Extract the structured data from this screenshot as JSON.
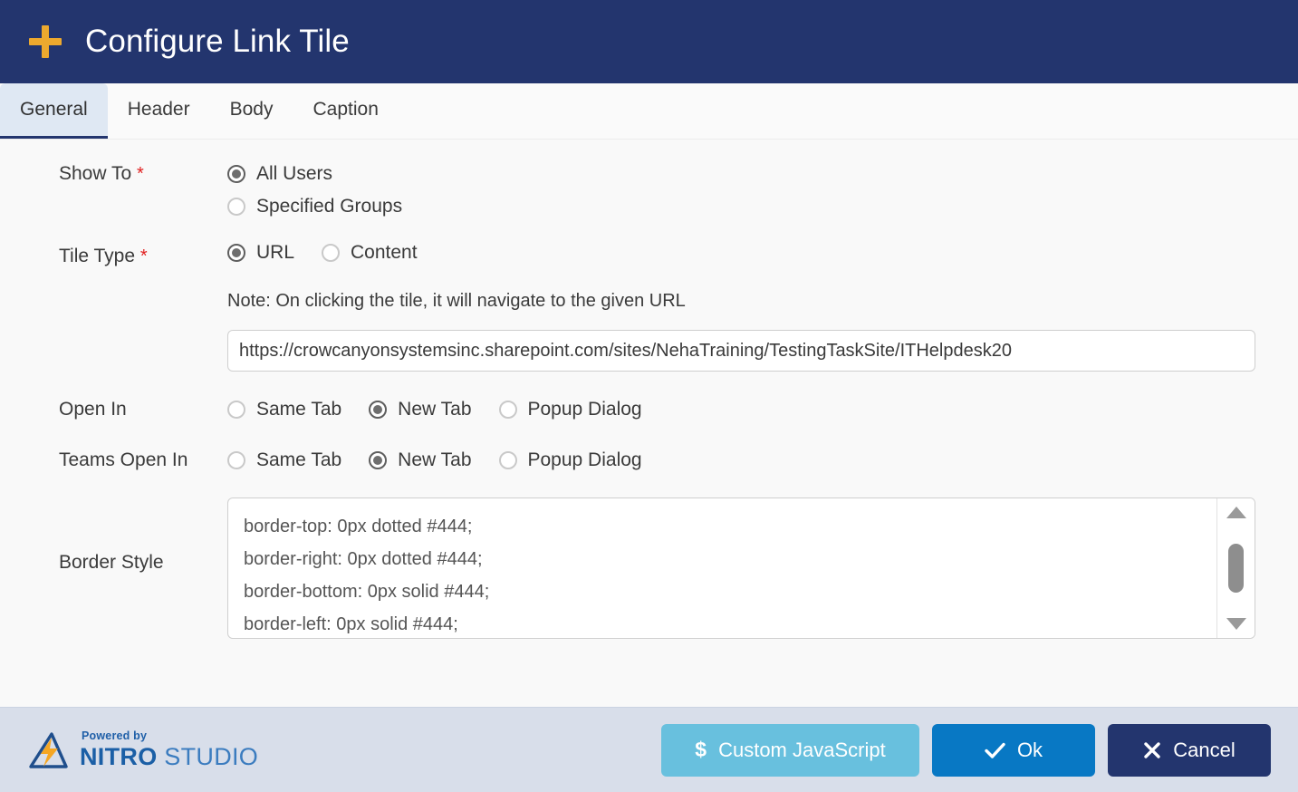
{
  "window": {
    "title": "Configure Link Tile",
    "add_icon": "plus-icon"
  },
  "tabs": [
    {
      "label": "General",
      "active": true
    },
    {
      "label": "Header",
      "active": false
    },
    {
      "label": "Body",
      "active": false
    },
    {
      "label": "Caption",
      "active": false
    }
  ],
  "form": {
    "show_to": {
      "label": "Show To",
      "required_marker": "*",
      "options": [
        {
          "label": "All Users",
          "selected": true
        },
        {
          "label": "Specified Groups",
          "selected": false
        }
      ]
    },
    "tile_type": {
      "label": "Tile Type",
      "required_marker": "*",
      "options": [
        {
          "label": "URL",
          "selected": true
        },
        {
          "label": "Content",
          "selected": false
        }
      ],
      "note": "Note: On clicking the tile, it will navigate to the given URL",
      "url_value": "https://crowcanyonsystemsinc.sharepoint.com/sites/NehaTraining/TestingTaskSite/ITHelpdesk20",
      "url_placeholder": ""
    },
    "open_in": {
      "label": "Open In",
      "options": [
        {
          "label": "Same Tab",
          "selected": false
        },
        {
          "label": "New Tab",
          "selected": true
        },
        {
          "label": "Popup Dialog",
          "selected": false
        }
      ]
    },
    "teams_open_in": {
      "label": "Teams Open In",
      "options": [
        {
          "label": "Same Tab",
          "selected": false
        },
        {
          "label": "New Tab",
          "selected": true
        },
        {
          "label": "Popup Dialog",
          "selected": false
        }
      ]
    },
    "border_style": {
      "label": "Border Style",
      "value": "border-top: 0px dotted #444;\nborder-right: 0px dotted #444;\nborder-bottom: 0px solid #444;\nborder-left: 0px solid #444;"
    }
  },
  "footer": {
    "logo": {
      "powered_by": "Powered by",
      "name_bold": "NITRO",
      "name_light": " STUDIO"
    },
    "buttons": [
      {
        "id": "custom-javascript",
        "label": "Custom JavaScript",
        "icon": "dollar-icon",
        "color": "#68C0DE"
      },
      {
        "id": "ok",
        "label": "Ok",
        "icon": "check-icon",
        "color": "#0878C4"
      },
      {
        "id": "cancel",
        "label": "Cancel",
        "icon": "close-icon",
        "color": "#23356E"
      }
    ]
  }
}
